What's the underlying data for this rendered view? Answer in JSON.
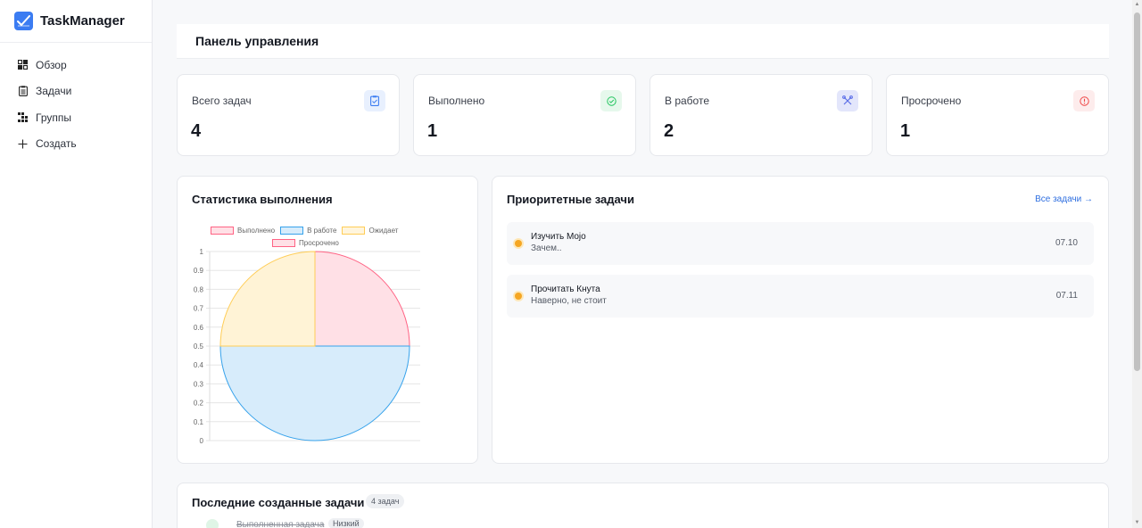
{
  "app": {
    "name": "TaskManager"
  },
  "sidebar": {
    "items": [
      {
        "label": "Обзор",
        "icon": "grid-icon"
      },
      {
        "label": "Задачи",
        "icon": "clipboard-icon"
      },
      {
        "label": "Группы",
        "icon": "groups-icon"
      },
      {
        "label": "Создать",
        "icon": "plus-icon"
      }
    ]
  },
  "header": {
    "title": "Панель управления"
  },
  "stats": [
    {
      "label": "Всего задач",
      "value": "4",
      "icon": "clipboard-check-icon",
      "color": "#3b7cf2"
    },
    {
      "label": "Выполнено",
      "value": "1",
      "icon": "check-circle-icon",
      "color": "#22c55e"
    },
    {
      "label": "В работе",
      "value": "2",
      "icon": "tools-icon",
      "color": "#5b6ee8"
    },
    {
      "label": "Просрочено",
      "value": "1",
      "icon": "alert-circle-icon",
      "color": "#ef4444"
    }
  ],
  "chart_panel": {
    "title": "Статистика выполнения"
  },
  "chart_data": {
    "type": "pie",
    "title": "",
    "categories": [
      "Выполнено",
      "В работе",
      "Ожидает",
      "Просрочено"
    ],
    "values": [
      1,
      2,
      1,
      0
    ],
    "colors": [
      "#ff6384",
      "#36a2eb",
      "#ffcd56",
      "#ff6384"
    ],
    "y_ticks": [
      "1",
      "0.9",
      "0.8",
      "0.7",
      "0.6",
      "0.5",
      "0.4",
      "0.3",
      "0.2",
      "0.1",
      "0"
    ],
    "ylim": [
      0,
      1
    ],
    "grid": true,
    "legend_position": "top"
  },
  "priority": {
    "title": "Приоритетные задачи",
    "all_link": "Все задачи →",
    "tasks": [
      {
        "title": "Изучить Mojo",
        "desc": "Зачем..",
        "date": "07.10"
      },
      {
        "title": "Прочитать Кнута",
        "desc": "Наверно, не стоит",
        "date": "07.11"
      }
    ]
  },
  "recent": {
    "title": "Последние созданные задачи",
    "count": "4 задач",
    "first_task": {
      "title": "Выполненная задача",
      "priority": "Низкий"
    }
  }
}
